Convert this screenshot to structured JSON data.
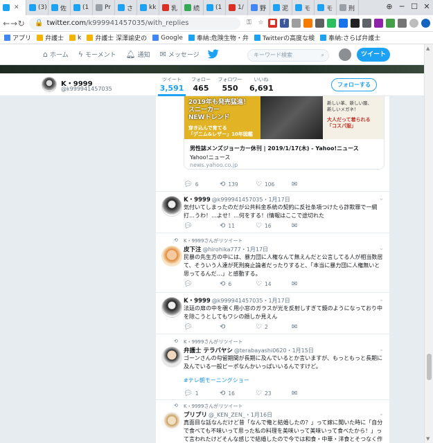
{
  "browser": {
    "tabs": [
      {
        "label": "",
        "color": "#1da1f2",
        "active": true
      },
      {
        "label": "(3)",
        "color": "#1da1f2"
      },
      {
        "label": "佐",
        "color": "#1da1f2"
      },
      {
        "label": "(1",
        "color": "#1da1f2"
      },
      {
        "label": "Pr",
        "color": "#9aa0a6"
      },
      {
        "label": "さ",
        "color": "#1da1f2"
      },
      {
        "label": "kk",
        "color": "#1da1f2"
      },
      {
        "label": "乳",
        "color": "#d93025"
      },
      {
        "label": "続",
        "color": "#34a853"
      },
      {
        "label": "(1",
        "color": "#1da1f2"
      },
      {
        "label": "1/",
        "color": "#d93025"
      },
      {
        "label": "野",
        "color": "#4285f4"
      },
      {
        "label": "泥",
        "color": "#1da1f2"
      },
      {
        "label": "モ",
        "color": "#1da1f2"
      },
      {
        "label": "モ",
        "color": "#1da1f2"
      },
      {
        "label": "刑",
        "color": "#9aa0a6"
      }
    ],
    "url_host": "twitter.com",
    "url_path": "/k999941457035/with_replies",
    "bookmarks": [
      {
        "label": "アプリ",
        "color": "#4285f4"
      },
      {
        "label": "弁護士",
        "color": "#f4b400"
      },
      {
        "label": "k",
        "color": "#f4b400"
      },
      {
        "label": "弁護士 深澤諭史の",
        "color": "#f4b400"
      },
      {
        "label": "Google",
        "color": "#4285f4"
      },
      {
        "label": "奉納:危険生物・弁",
        "color": "#1da1f2"
      },
      {
        "label": "Twitterの高度な検",
        "color": "#1da1f2"
      },
      {
        "label": "奉納:さらば弁護士",
        "color": "#1da1f2"
      }
    ]
  },
  "twitter_nav": {
    "home": "ホーム",
    "moments": "モーメント",
    "notifications": "通知",
    "messages": "メッセージ",
    "search_placeholder": "キーワード検索",
    "tweet_button": "ツイート"
  },
  "profile": {
    "name": "K・9999",
    "handle": "@k999941457035",
    "stats": [
      {
        "label": "ツイート",
        "value": "3,591"
      },
      {
        "label": "フォロー",
        "value": "465"
      },
      {
        "label": "フォロワー",
        "value": "550"
      },
      {
        "label": "いいね",
        "value": "6,691"
      }
    ],
    "follow_button": "フォローする"
  },
  "card": {
    "image_text_1": "2019年も発売猛進！\nスニーカー\nNEWトレンド",
    "image_text_2": "穿き込んで育てる\n「デニム&レザー」10年図鑑",
    "image_text_3": "新しい革、新しい服、\n新しいメガネ！",
    "image_text_4": "大人だって着られる\n「コスパ服」",
    "title": "男性誌メンズジョーカー休刊 | 2019/1/17(木) - Yahoo!ニュース",
    "description": "Yahoo!ニュース",
    "url": "news.yahoo.co.jp"
  },
  "tweets": [
    {
      "actions": {
        "reply": "6",
        "retweet": "139",
        "like": "106"
      }
    },
    {
      "name": "K・9999",
      "handle": "@k999941457035",
      "date": "・1月17日",
      "text": "気付いてしまったのだが公共料金系統の契約に反社条項つけたら詐欺罪で一網打…うわ！…よせ！…何をする！(情報はここで途切れた",
      "actions": {
        "reply": "",
        "retweet": "11",
        "like": "16"
      }
    },
    {
      "retweeted_by": "K・9999さんがリツイート",
      "name": "皮下注",
      "handle": "@hirohika777",
      "date": "・1月17日",
      "text": "民暴の先生方の中には、暴力団に人権なんて無えんだと公言してる人が相当数居て、そういう人達が死刑廃止論者だったりすると、「本当に暴力団に人権無いと思ってるんだ…」と感動する。",
      "actions": {
        "reply": "",
        "retweet": "6",
        "like": "14"
      }
    },
    {
      "name": "K・9999",
      "handle": "@k999941457035",
      "date": "・1月17日",
      "text": "法廷の扉の中を覗く用小窓のガラスが光を反射しすぎて鏡のようになっており中を除こうとしてもワシの顔しか見えん",
      "actions": {
        "reply": "",
        "retweet": "",
        "like": "2"
      }
    },
    {
      "retweeted_by": "K・9999さんがリツイート",
      "name": "弁護士 テラバヤシ",
      "handle": "@terabayashi0620",
      "date": "・1月15日",
      "text": "ゴーンさんの勾留期間が長期に及んでいるとか言いますが、もっともっと長期に及んでいる一般ピーポなんかいっぱいいるんですけど。",
      "hashtag": "#テレ朝モーニングショー",
      "actions": {
        "reply": "1",
        "retweet": "16",
        "like": "23"
      }
    },
    {
      "retweeted_by": "K・9999さんがリツイート",
      "name": "プリプリ",
      "handle": "@_KEN_ZEN_",
      "date": "・1月16日",
      "text": "真面目な話なんだけど昔「なんで俺と結婚したの？」って嫁に聞いた時に「自分で食べても不味いって思った私の料理を美味いって美味いって食べたから！」って言われたけどそんな感じで結婚したので今では和食・中華・洋食とそつなく作れるようになりました！"
    }
  ]
}
